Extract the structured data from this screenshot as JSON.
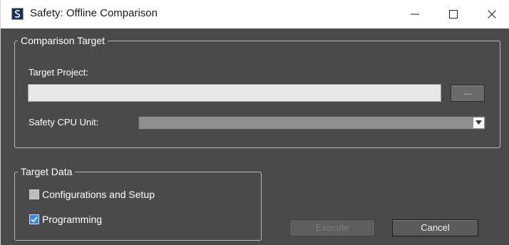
{
  "window": {
    "title": "Safety: Offline Comparison"
  },
  "comparison_target": {
    "legend": "Comparison Target",
    "target_project_label": "Target Project:",
    "target_project_value": "",
    "browse_label": "...",
    "safety_cpu_label": "Safety CPU Unit:",
    "safety_cpu_value": ""
  },
  "target_data": {
    "legend": "Target Data",
    "items": [
      {
        "label": "Configurations and Setup",
        "checked": false
      },
      {
        "label": "Programming",
        "checked": true
      }
    ]
  },
  "buttons": {
    "execute_label": "Execute",
    "execute_enabled": false,
    "cancel_label": "Cancel"
  },
  "icons": {
    "app": "app-icon",
    "minimize": "minimize-icon",
    "maximize": "maximize-icon",
    "close": "close-icon",
    "dropdown": "chevron-down-icon",
    "check": "checkmark-icon"
  },
  "colors": {
    "dialog_background": "#4a4a4a",
    "checkbox_checked": "#3f86e0"
  }
}
